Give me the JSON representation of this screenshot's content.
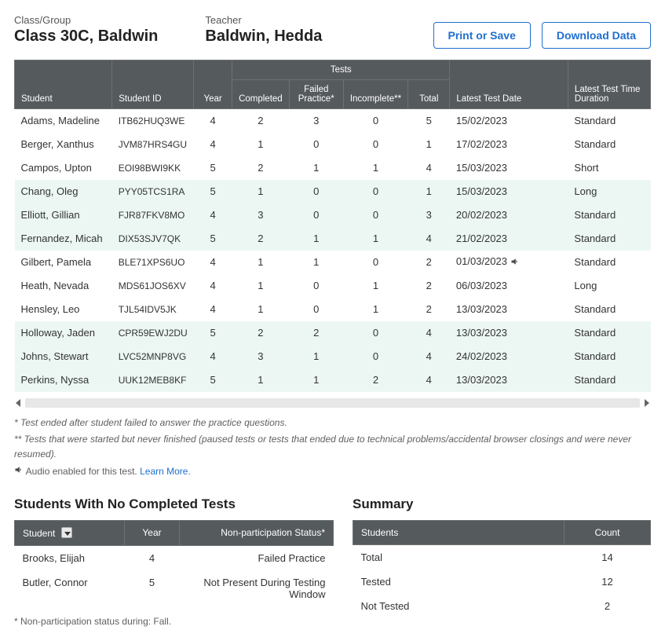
{
  "header": {
    "classLabel": "Class/Group",
    "classValue": "Class 30C, Baldwin",
    "teacherLabel": "Teacher",
    "teacherValue": "Baldwin, Hedda",
    "printBtn": "Print or Save",
    "downloadBtn": "Download Data"
  },
  "mainTable": {
    "headers": {
      "student": "Student",
      "studentId": "Student  ID",
      "year": "Year",
      "testsGroup": "Tests",
      "completed": "Completed",
      "failed": "Failed Practice*",
      "incomplete": "Incomplete**",
      "total": "Total",
      "latestDate": "Latest Test Date",
      "latestDur": "Latest Test Time Duration"
    },
    "rows": [
      {
        "name": "Adams, Madeline",
        "id": "ITB62HUQ3WE",
        "year": "4",
        "completed": "2",
        "failed": "3",
        "incomplete": "0",
        "total": "5",
        "date": "15/02/2023",
        "audio": false,
        "dur": "Standard",
        "tint": false
      },
      {
        "name": "Berger, Xanthus",
        "id": "JVM87HRS4GU",
        "year": "4",
        "completed": "1",
        "failed": "0",
        "incomplete": "0",
        "total": "1",
        "date": "17/02/2023",
        "audio": false,
        "dur": "Standard",
        "tint": false
      },
      {
        "name": "Campos, Upton",
        "id": "EOI98BWI9KK",
        "year": "5",
        "completed": "2",
        "failed": "1",
        "incomplete": "1",
        "total": "4",
        "date": "15/03/2023",
        "audio": false,
        "dur": "Short",
        "tint": false
      },
      {
        "name": "Chang, Oleg",
        "id": "PYY05TCS1RA",
        "year": "5",
        "completed": "1",
        "failed": "0",
        "incomplete": "0",
        "total": "1",
        "date": "15/03/2023",
        "audio": false,
        "dur": "Long",
        "tint": true
      },
      {
        "name": "Elliott, Gillian",
        "id": "FJR87FKV8MO",
        "year": "4",
        "completed": "3",
        "failed": "0",
        "incomplete": "0",
        "total": "3",
        "date": "20/02/2023",
        "audio": false,
        "dur": "Standard",
        "tint": true
      },
      {
        "name": "Fernandez, Micah",
        "id": "DIX53SJV7QK",
        "year": "5",
        "completed": "2",
        "failed": "1",
        "incomplete": "1",
        "total": "4",
        "date": "21/02/2023",
        "audio": false,
        "dur": "Standard",
        "tint": true
      },
      {
        "name": "Gilbert, Pamela",
        "id": "BLE71XPS6UO",
        "year": "4",
        "completed": "1",
        "failed": "1",
        "incomplete": "0",
        "total": "2",
        "date": "01/03/2023",
        "audio": true,
        "dur": "Standard",
        "tint": false
      },
      {
        "name": "Heath, Nevada",
        "id": "MDS61JOS6XV",
        "year": "4",
        "completed": "1",
        "failed": "0",
        "incomplete": "1",
        "total": "2",
        "date": "06/03/2023",
        "audio": false,
        "dur": "Long",
        "tint": false
      },
      {
        "name": "Hensley, Leo",
        "id": "TJL54IDV5JK",
        "year": "4",
        "completed": "1",
        "failed": "0",
        "incomplete": "1",
        "total": "2",
        "date": "13/03/2023",
        "audio": false,
        "dur": "Standard",
        "tint": false
      },
      {
        "name": "Holloway, Jaden",
        "id": "CPR59EWJ2DU",
        "year": "5",
        "completed": "2",
        "failed": "2",
        "incomplete": "0",
        "total": "4",
        "date": "13/03/2023",
        "audio": false,
        "dur": "Standard",
        "tint": true
      },
      {
        "name": "Johns, Stewart",
        "id": "LVC52MNP8VG",
        "year": "4",
        "completed": "3",
        "failed": "1",
        "incomplete": "0",
        "total": "4",
        "date": "24/02/2023",
        "audio": false,
        "dur": "Standard",
        "tint": true
      },
      {
        "name": "Perkins, Nyssa",
        "id": "UUK12MEB8KF",
        "year": "5",
        "completed": "1",
        "failed": "1",
        "incomplete": "2",
        "total": "4",
        "date": "13/03/2023",
        "audio": false,
        "dur": "Standard",
        "tint": true
      }
    ]
  },
  "footnotes": {
    "line1": "* Test ended after student failed to answer the practice questions.",
    "line2": "** Tests that were started but never finished (paused tests or tests that ended due to technical problems/accidental browser closings and were never resumed).",
    "line3Pre": " Audio enabled for this test. ",
    "learnMore": "Learn More."
  },
  "noTests": {
    "title": "Students With No Completed Tests",
    "headers": {
      "student": "Student",
      "year": "Year",
      "status": "Non-participation Status*"
    },
    "rows": [
      {
        "name": "Brooks, Elijah",
        "year": "4",
        "status": "Failed Practice"
      },
      {
        "name": "Butler, Connor",
        "year": "5",
        "status": "Not Present During Testing Window"
      }
    ],
    "footnote": "* Non-participation status during: Fall."
  },
  "summary": {
    "title": "Summary",
    "headers": {
      "students": "Students",
      "count": "Count"
    },
    "rows": [
      {
        "label": "Total",
        "count": "14"
      },
      {
        "label": "Tested",
        "count": "12"
      },
      {
        "label": "Not Tested",
        "count": "2"
      }
    ]
  }
}
